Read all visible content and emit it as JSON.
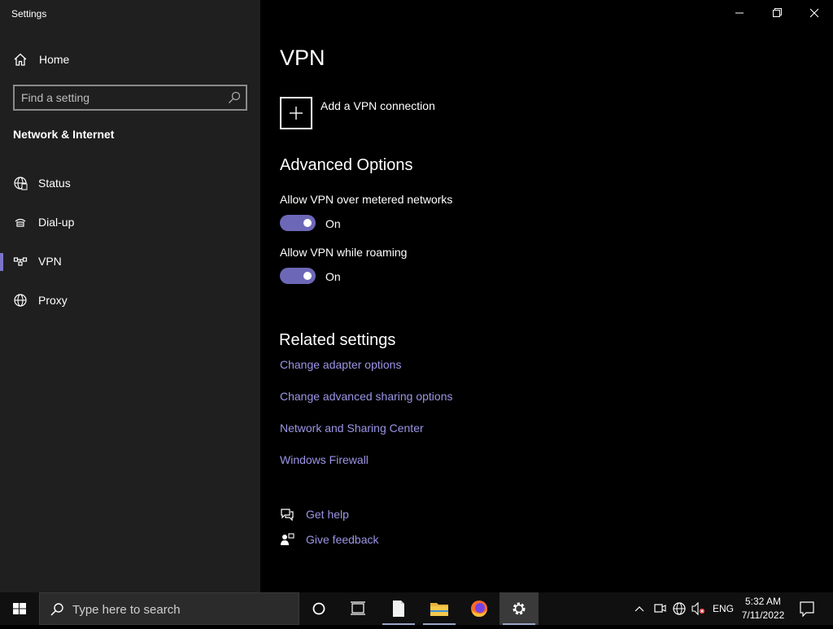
{
  "window": {
    "app_title": "Settings"
  },
  "sidebar": {
    "home_label": "Home",
    "search_placeholder": "Find a setting",
    "section_title": "Network & Internet",
    "items": [
      {
        "label": "Status",
        "icon": "globe-status-icon",
        "selected": false
      },
      {
        "label": "Dial-up",
        "icon": "dialup-icon",
        "selected": false
      },
      {
        "label": "VPN",
        "icon": "vpn-icon",
        "selected": true
      },
      {
        "label": "Proxy",
        "icon": "globe-icon",
        "selected": false
      }
    ]
  },
  "main": {
    "page_title": "VPN",
    "add_vpn_label": "Add a VPN connection",
    "advanced_title": "Advanced Options",
    "options": [
      {
        "label": "Allow VPN over metered networks",
        "state": "On",
        "on": true
      },
      {
        "label": "Allow VPN while roaming",
        "state": "On",
        "on": true
      }
    ],
    "related_title": "Related settings",
    "related_links": [
      "Change adapter options",
      "Change advanced sharing options",
      "Network and Sharing Center",
      "Windows Firewall"
    ],
    "get_help": "Get help",
    "give_feedback": "Give feedback"
  },
  "taskbar": {
    "search_placeholder": "Type here to search",
    "language": "ENG",
    "time": "5:32 AM",
    "date": "7/11/2022"
  },
  "colors": {
    "accent": "#6d67b8",
    "link": "#9b95e6",
    "sidebar_bg": "#1f1f1f"
  }
}
